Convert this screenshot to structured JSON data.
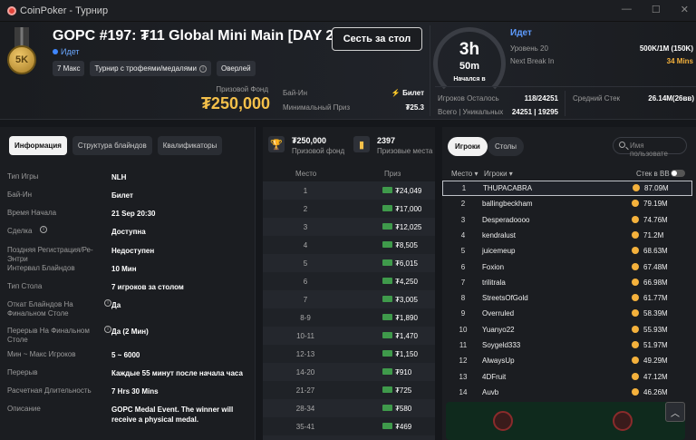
{
  "window": {
    "title": "CoinPoker - Турнир"
  },
  "header": {
    "title": "GOPC #197: ₮11 Global Mini Main [DAY 2]",
    "status": "Идет",
    "medal_text": "5K",
    "tags": [
      "7 Макс",
      "Турнир с трофеями/медалями",
      "Оверлей"
    ],
    "sit_button": "Сесть за стол",
    "prize_pool_label": "Призовой Фонд",
    "prize_pool": "₮250,000",
    "buyin_label": "Бай-Ин",
    "buyin_value": "Билет",
    "min_prize_label": "Минимальный Приз",
    "min_prize_value": "₮25.3",
    "clock_hours": "3h",
    "clock_minutes": "50m",
    "clock_sub": "Начался в",
    "state": "Идет",
    "level_label": "Уровень 20",
    "level_value": "500K/1M (150K)",
    "next_break_label": "Next Break In",
    "next_break_value": "34 Mins",
    "players_left_label": "Игроков Осталось",
    "players_left_value": "118/24251",
    "total_unique_label": "Всего | Уникальных",
    "total_unique_value": "24251 | 19295",
    "avg_stack_label": "Средний Стек",
    "avg_stack_value": "26.14M(26вв)"
  },
  "info_tabs": [
    "Информация",
    "Структура блайндов",
    "Квалификаторы"
  ],
  "info": [
    {
      "k": "Тип Игры",
      "v": "NLH"
    },
    {
      "k": "Бай-Ин",
      "v": "Билет"
    },
    {
      "k": "Время Начала",
      "v": "21 Sep 20:30"
    },
    {
      "k": "Сделка",
      "v": "Доступна"
    },
    {
      "k": "Поздняя Регистрация/Ре-Энтри",
      "v": "Недоступен"
    },
    {
      "k": "Интервал Блайндов",
      "v": "10 Мин"
    },
    {
      "k": "Тип Стола",
      "v": "7 игроков за столом"
    },
    {
      "k": "Откат Блайндов На Финальном Столе",
      "v": "Да"
    },
    {
      "k": "Перерыв На Финальном Столе",
      "v": "Да (2 Мин)"
    },
    {
      "k": "Мин ~ Макс Игроков",
      "v": "5 ~ 6000"
    },
    {
      "k": "Перерыв",
      "v": "Каждые 55 минут после начала часа"
    },
    {
      "k": "Расчетная Длительность",
      "v": "7 Hrs 30 Mins"
    },
    {
      "k": "Описание",
      "v": "GOPC Medal Event. The winner will receive a physical medal."
    }
  ],
  "prizes": {
    "pool_value": "₮250,000",
    "pool_label": "Призовой фонд",
    "places_value": "2397",
    "places_label": "Призовые места",
    "col_place": "Место",
    "col_prize": "Приз",
    "rows": [
      {
        "p": "1",
        "v": "₮24,049"
      },
      {
        "p": "2",
        "v": "₮17,000"
      },
      {
        "p": "3",
        "v": "₮12,025"
      },
      {
        "p": "4",
        "v": "₮8,505"
      },
      {
        "p": "5",
        "v": "₮6,015"
      },
      {
        "p": "6",
        "v": "₮4,250"
      },
      {
        "p": "7",
        "v": "₮3,005"
      },
      {
        "p": "8-9",
        "v": "₮1,890"
      },
      {
        "p": "10-11",
        "v": "₮1,470"
      },
      {
        "p": "12-13",
        "v": "₮1,150"
      },
      {
        "p": "14-20",
        "v": "₮910"
      },
      {
        "p": "21-27",
        "v": "₮725"
      },
      {
        "p": "28-34",
        "v": "₮580"
      },
      {
        "p": "35-41",
        "v": "₮469"
      }
    ]
  },
  "players": {
    "tabs": [
      "Игроки",
      "Столы"
    ],
    "search_placeholder": "Имя пользовате",
    "col_place": "Место ▾",
    "col_player": "Игроки ▾",
    "col_stack": "Стек в BB",
    "rows": [
      {
        "n": "1",
        "name": "THUPACABRA",
        "stack": "87.09M"
      },
      {
        "n": "2",
        "name": "ballingbeckham",
        "stack": "79.19M"
      },
      {
        "n": "3",
        "name": "Desperadoooo",
        "stack": "74.76M"
      },
      {
        "n": "4",
        "name": "kendralust",
        "stack": "71.2M"
      },
      {
        "n": "5",
        "name": "juicemeup",
        "stack": "68.63M"
      },
      {
        "n": "6",
        "name": "Foxion",
        "stack": "67.48M"
      },
      {
        "n": "7",
        "name": "trilitrala",
        "stack": "66.98M"
      },
      {
        "n": "8",
        "name": "StreetsOfGold",
        "stack": "61.77M"
      },
      {
        "n": "9",
        "name": "Overruled",
        "stack": "58.39M"
      },
      {
        "n": "10",
        "name": "Yuanyo22",
        "stack": "55.93M"
      },
      {
        "n": "11",
        "name": "Soygeld333",
        "stack": "51.97M"
      },
      {
        "n": "12",
        "name": "AlwaysUp",
        "stack": "49.29M"
      },
      {
        "n": "13",
        "name": "4DFruit",
        "stack": "47.12M"
      },
      {
        "n": "14",
        "name": "Auvb",
        "stack": "46.26M"
      }
    ]
  }
}
